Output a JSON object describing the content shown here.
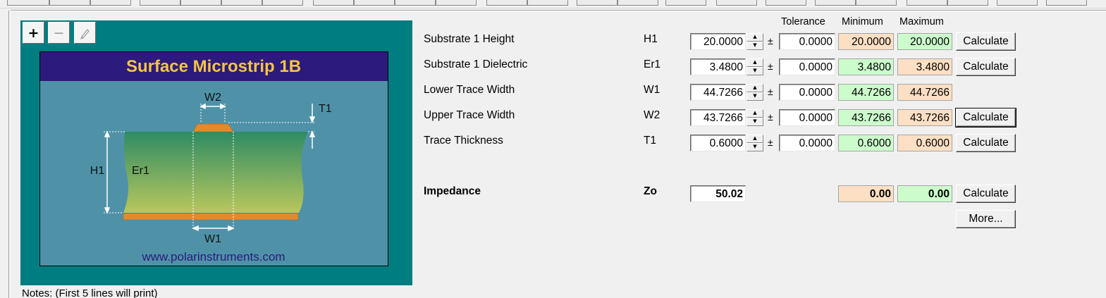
{
  "diagram": {
    "title": "Surface Microstrip 1B",
    "website": "www.polarinstruments.com",
    "labels": {
      "w2": "W2",
      "t1": "T1",
      "h1": "H1",
      "er1": "Er1",
      "w1": "W1"
    },
    "zoom_in_label": "+",
    "zoom_out_label": "−",
    "colors": {
      "frame": "#007d80",
      "title_bar": "#2c1a7c",
      "title_text": "#f5c542",
      "background": "#4f92a8",
      "trace": "#e4892c"
    }
  },
  "columns": {
    "tolerance": "Tolerance",
    "minimum": "Minimum",
    "maximum": "Maximum"
  },
  "params": [
    {
      "label": "Substrate 1 Height",
      "symbol": "H1",
      "value": "20.0000",
      "pm": "±",
      "tolerance": "0.0000",
      "min": "20.0000",
      "max": "20.0000",
      "calc": "Calculate"
    },
    {
      "label": "Substrate 1 Dielectric",
      "symbol": "Er1",
      "value": "3.4800",
      "pm": "±",
      "tolerance": "0.0000",
      "min": "3.4800",
      "max": "3.4800",
      "calc": "Calculate"
    },
    {
      "label": "Lower Trace Width",
      "symbol": "W1",
      "value": "44.7266",
      "pm": "±",
      "tolerance": "0.0000",
      "min": "44.7266",
      "max": "44.7266",
      "calc": ""
    },
    {
      "label": "Upper Trace Width",
      "symbol": "W2",
      "value": "43.7266",
      "pm": "±",
      "tolerance": "0.0000",
      "min": "43.7266",
      "max": "43.7266",
      "calc": "Calculate"
    },
    {
      "label": "Trace Thickness",
      "symbol": "T1",
      "value": "0.6000",
      "pm": "±",
      "tolerance": "0.0000",
      "min": "0.6000",
      "max": "0.6000",
      "calc": "Calculate"
    }
  ],
  "impedance": {
    "label": "Impedance",
    "symbol": "Zo",
    "value": "50.02",
    "min": "0.00",
    "max": "0.00",
    "calc": "Calculate",
    "more": "More..."
  },
  "notes_label": "Notes: (First 5 lines will print)"
}
